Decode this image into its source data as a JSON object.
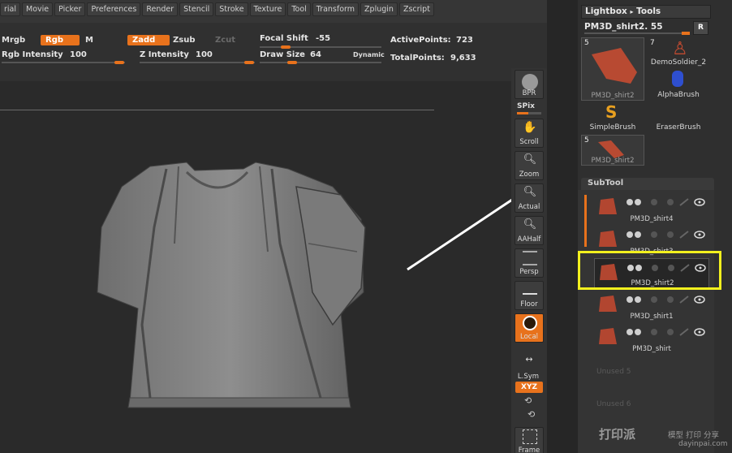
{
  "menu": [
    "rial",
    "Movie",
    "Picker",
    "Preferences",
    "Render",
    "Stencil",
    "Stroke",
    "Texture",
    "Tool",
    "Transform",
    "Zplugin",
    "Zscript"
  ],
  "shelf": {
    "mrgb": "Mrgb",
    "rgb": "Rgb",
    "m": "M",
    "zadd": "Zadd",
    "zsub": "Zsub",
    "zcut": "Zcut",
    "focal_shift_label": "Focal Shift",
    "focal_shift_value": "-55",
    "active_points_label": "ActivePoints:",
    "active_points_value": "723",
    "rgb_intensity_label": "Rgb Intensity",
    "rgb_intensity_value": "100",
    "z_intensity_label": "Z Intensity",
    "z_intensity_value": "100",
    "draw_size_label": "Draw Size",
    "draw_size_value": "64",
    "dynamic": "Dynamic",
    "total_points_label": "TotalPoints:",
    "total_points_value": "9,633"
  },
  "right_toolbar": {
    "bpr": "BPR",
    "spix": "SPix",
    "scroll": "Scroll",
    "zoom": "Zoom",
    "actual": "Actual",
    "aahalf": "AAHalf",
    "persp": "Persp",
    "floor": "Floor",
    "local": "Local",
    "lsym": "L.Sym",
    "xyz": "XYZ",
    "frame": "Frame"
  },
  "tool_panel": {
    "lightbox_label": "Lightbox",
    "tools_label": "Tools",
    "current_tool_name": "PM3D_shirt2.",
    "current_tool_value": "55",
    "r_button": "R",
    "thumbs": [
      {
        "num": "5",
        "caption": "PM3D_shirt2"
      },
      {
        "num": "7",
        "caption": "DemoSoldier_2"
      },
      {
        "num": "",
        "caption": "AlphaBrush"
      },
      {
        "num": "",
        "caption": "SimpleBrush"
      },
      {
        "num": "",
        "caption": "EraserBrush"
      },
      {
        "num": "5",
        "caption": "PM3D_shirt2"
      }
    ]
  },
  "subtool": {
    "header": "SubTool",
    "items": [
      "PM3D_shirt4",
      "PM3D_shirt3",
      "PM3D_shirt2",
      "PM3D_shirt1",
      "PM3D_shirt"
    ],
    "unused": [
      "Unused 5",
      "Unused 6"
    ]
  },
  "watermark": {
    "brand": "打印派",
    "tag": "模型 打印 分享",
    "url": "dayinpai.com"
  },
  "colors": {
    "accent": "#e8721c",
    "highlight": "#f2f01e",
    "background": "#2b2b2b"
  }
}
